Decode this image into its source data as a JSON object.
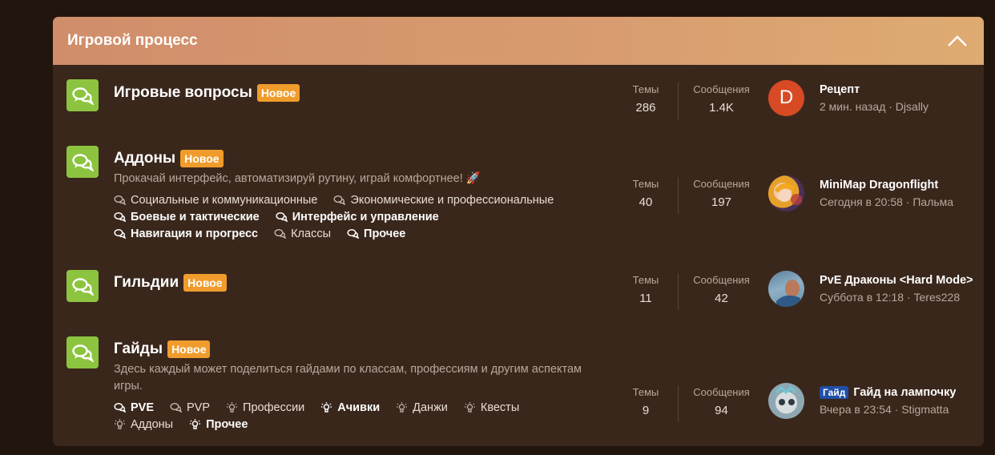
{
  "category": {
    "title": "Игровой процесс"
  },
  "labels": {
    "topics": "Темы",
    "messages": "Сообщения"
  },
  "colors": {
    "header_start": "#d08d6a",
    "header_end": "#deab72",
    "badge": "#f09c2c",
    "node_icon": "#8dc43f",
    "prefix": "#1f4fa8",
    "avatar_d": "#d84a23"
  },
  "nodes": [
    {
      "title": "Игровые вопросы",
      "badge": "Новое",
      "topics": "286",
      "messages": "1.4K",
      "last": {
        "avatar_letter": "D",
        "title": "Рецепт",
        "meta": "2 мин. назад · Djsally"
      }
    },
    {
      "title": "Аддоны",
      "badge": "Новое",
      "description": "Прокачай интерфейс, автоматизируй рутину, играй комфортнее! 🚀",
      "subforums": [
        {
          "label": "Социальные и коммуникационные",
          "icon": "comments-icon"
        },
        {
          "label": "Экономические и профессиональные",
          "icon": "comments-icon"
        },
        {
          "label": "Боевые и тактические",
          "icon": "comments-icon"
        },
        {
          "label": "Интерфейс и управление",
          "icon": "comments-icon"
        },
        {
          "label": "Навигация и прогресс",
          "icon": "comments-icon"
        },
        {
          "label": "Классы",
          "icon": "comments-icon"
        },
        {
          "label": "Прочее",
          "icon": "comments-icon"
        }
      ],
      "topics": "40",
      "messages": "197",
      "last": {
        "title": "MiniMap Dragonflight",
        "meta": "Сегодня в 20:58 · Пальма"
      }
    },
    {
      "title": "Гильдии",
      "badge": "Новое",
      "topics": "11",
      "messages": "42",
      "last": {
        "title": "PvE Драконы <Hard Mode>",
        "meta": "Суббота в 12:18 · Teres228"
      }
    },
    {
      "title": "Гайды",
      "badge": "Новое",
      "description": "Здесь каждый может поделиться гайдами по классам, профессиям и другим аспектам игры.",
      "subforums": [
        {
          "label": "PVE",
          "icon": "comments-icon"
        },
        {
          "label": "PVP",
          "icon": "comments-icon"
        },
        {
          "label": "Профессии",
          "icon": "lightbulb-icon"
        },
        {
          "label": "Ачивки",
          "icon": "lightbulb-icon"
        },
        {
          "label": "Данжи",
          "icon": "lightbulb-icon"
        },
        {
          "label": "Квесты",
          "icon": "lightbulb-icon"
        },
        {
          "label": "Аддоны",
          "icon": "lightbulb-icon"
        },
        {
          "label": "Прочее",
          "icon": "lightbulb-icon"
        }
      ],
      "topics": "9",
      "messages": "94",
      "last": {
        "prefix": "Гайд",
        "title": "Гайд на лампочку",
        "meta": "Вчера в 23:54 · Stigmatta"
      }
    }
  ]
}
